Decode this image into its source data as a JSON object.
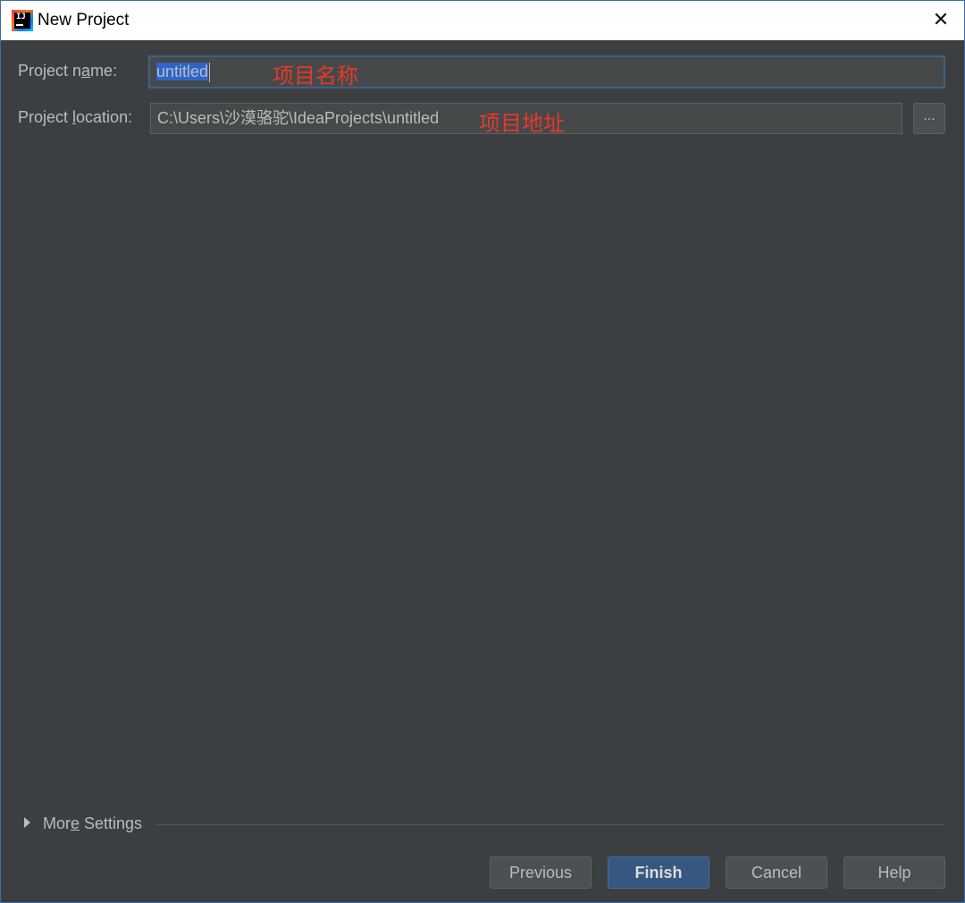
{
  "window": {
    "title": "New Project",
    "close_glyph": "✕",
    "app_icon_text": "IJ"
  },
  "form": {
    "name_label": {
      "pre": "Project n",
      "mnemonic": "a",
      "post": "me:"
    },
    "name_value": "untitled",
    "name_annotation": "项目名称",
    "location_label": {
      "pre": "Project ",
      "mnemonic": "l",
      "post": "ocation:"
    },
    "location_value": "C:\\Users\\沙漠骆驼\\IdeaProjects\\untitled",
    "location_annotation": "项目地址",
    "browse_label": "..."
  },
  "more_settings": {
    "pre": "Mor",
    "mnemonic": "e",
    "post": " Settings"
  },
  "buttons": {
    "previous": "Previous",
    "finish": "Finish",
    "cancel": "Cancel",
    "help": "Help"
  },
  "colors": {
    "background": "#3c3f41",
    "text": "#bbbbbb",
    "selection": "#2f65ca",
    "annotation": "#e8382b",
    "primary_button": "#365880"
  }
}
